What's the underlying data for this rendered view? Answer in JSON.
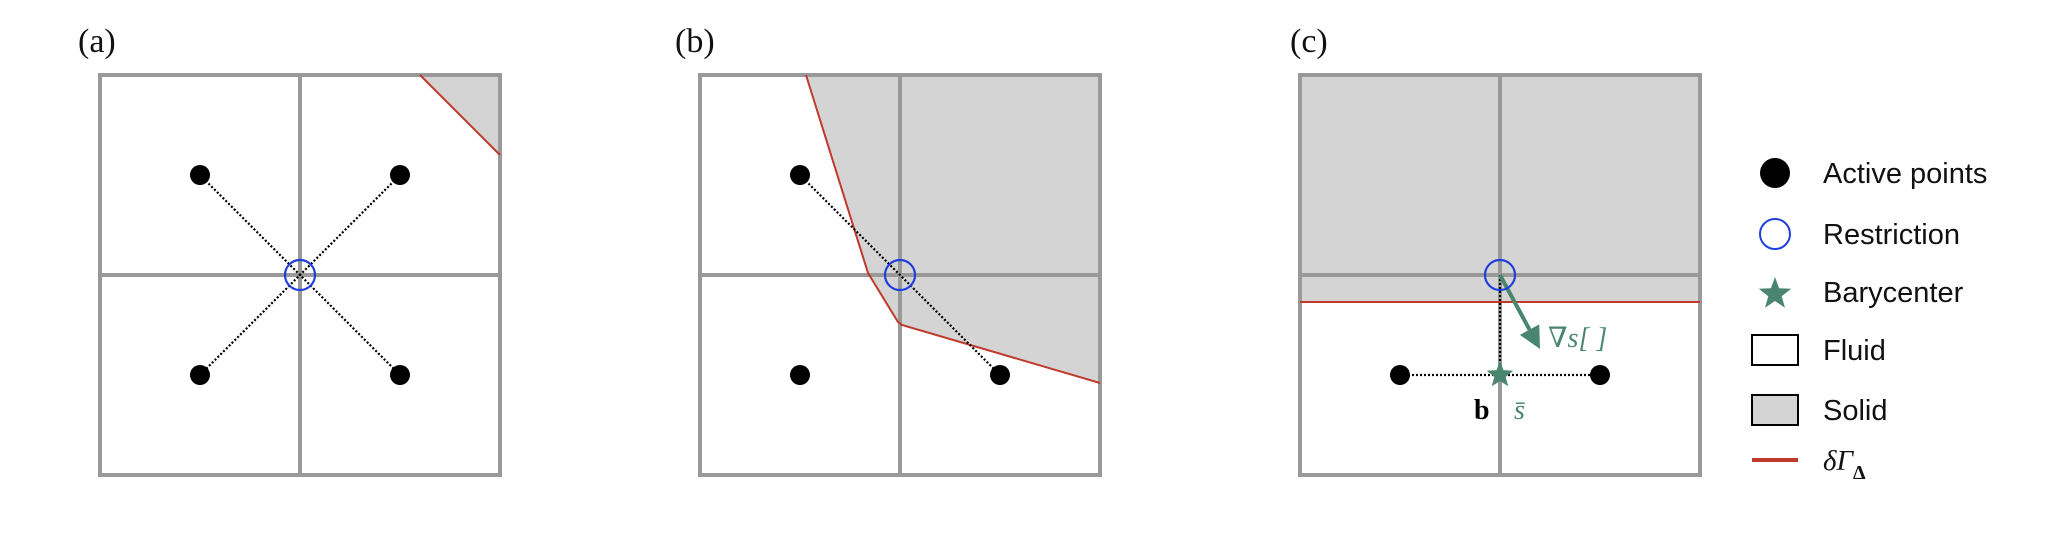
{
  "figure": {
    "colors": {
      "grid": "#999999",
      "solid_fill": "#d4d4d4",
      "fluid_fill": "#ffffff",
      "boundary": "#c0392b",
      "restriction": "#1f3fe0",
      "barycenter": "#4a8570",
      "active_point": "#000000",
      "stencil_line": "#000000"
    },
    "panels": [
      {
        "label": "(a)",
        "solid_polygon": [
          [
            1.6,
            0
          ],
          [
            2,
            0
          ],
          [
            2,
            0.4
          ]
        ],
        "boundary_path": [
          [
            1.6,
            0
          ],
          [
            2,
            0.4
          ]
        ],
        "active_points": [
          [
            0.5,
            0.5
          ],
          [
            1.5,
            0.5
          ],
          [
            0.5,
            1.5
          ],
          [
            1.5,
            1.5
          ]
        ],
        "stencil_lines": [
          [
            [
              0.5,
              0.5
            ],
            [
              1.5,
              1.5
            ]
          ],
          [
            [
              1.5,
              0.5
            ],
            [
              0.5,
              1.5
            ]
          ]
        ],
        "restriction": [
          1,
          1
        ]
      },
      {
        "label": "(b)",
        "solid_polygon": [
          [
            0.53,
            0
          ],
          [
            2,
            0
          ],
          [
            2,
            1.54
          ],
          [
            1.01,
            1.25
          ],
          [
            0.99,
            1.235
          ],
          [
            0.84,
            0.99
          ]
        ],
        "boundary_path": [
          [
            0.53,
            0
          ],
          [
            0.84,
            0.99
          ],
          [
            0.99,
            1.235
          ],
          [
            1.01,
            1.25
          ],
          [
            2,
            1.54
          ]
        ],
        "active_points": [
          [
            0.5,
            0.5
          ],
          [
            0.5,
            1.5
          ],
          [
            1.5,
            1.5
          ]
        ],
        "stencil_lines": [
          [
            [
              0.5,
              0.5
            ],
            [
              1.5,
              1.5
            ]
          ]
        ],
        "restriction": [
          1,
          1
        ]
      },
      {
        "label": "(c)",
        "solid_polygon": [
          [
            0,
            0
          ],
          [
            2,
            0
          ],
          [
            2,
            1.135
          ],
          [
            0,
            1.135
          ]
        ],
        "boundary_path": [
          [
            0,
            1.135
          ],
          [
            2,
            1.135
          ]
        ],
        "active_points": [
          [
            0.5,
            1.5
          ],
          [
            1.5,
            1.5
          ]
        ],
        "stencil_lines": [
          [
            [
              0.5,
              1.5
            ],
            [
              1.5,
              1.5
            ]
          ],
          [
            [
              1,
              1
            ],
            [
              1,
              1.5
            ]
          ]
        ],
        "restriction": [
          1,
          1
        ],
        "barycenter": [
          1,
          1.5
        ],
        "gradient_arrow": [
          [
            1,
            1
          ],
          [
            1.2,
            1.37
          ]
        ],
        "annotations": {
          "gradient_label": "∇s[ ]",
          "b_label": "b",
          "sbar_label": "s̄"
        }
      }
    ],
    "legend": {
      "items": [
        {
          "symbol": "filled-circle",
          "label": "Active points"
        },
        {
          "symbol": "open-circle",
          "label": "Restriction"
        },
        {
          "symbol": "star",
          "label": "Barycenter"
        },
        {
          "symbol": "white-box",
          "label": "Fluid"
        },
        {
          "symbol": "gray-box",
          "label": "Solid"
        },
        {
          "symbol": "red-line",
          "label": "δΓ",
          "subscript": "Δ"
        }
      ]
    }
  }
}
